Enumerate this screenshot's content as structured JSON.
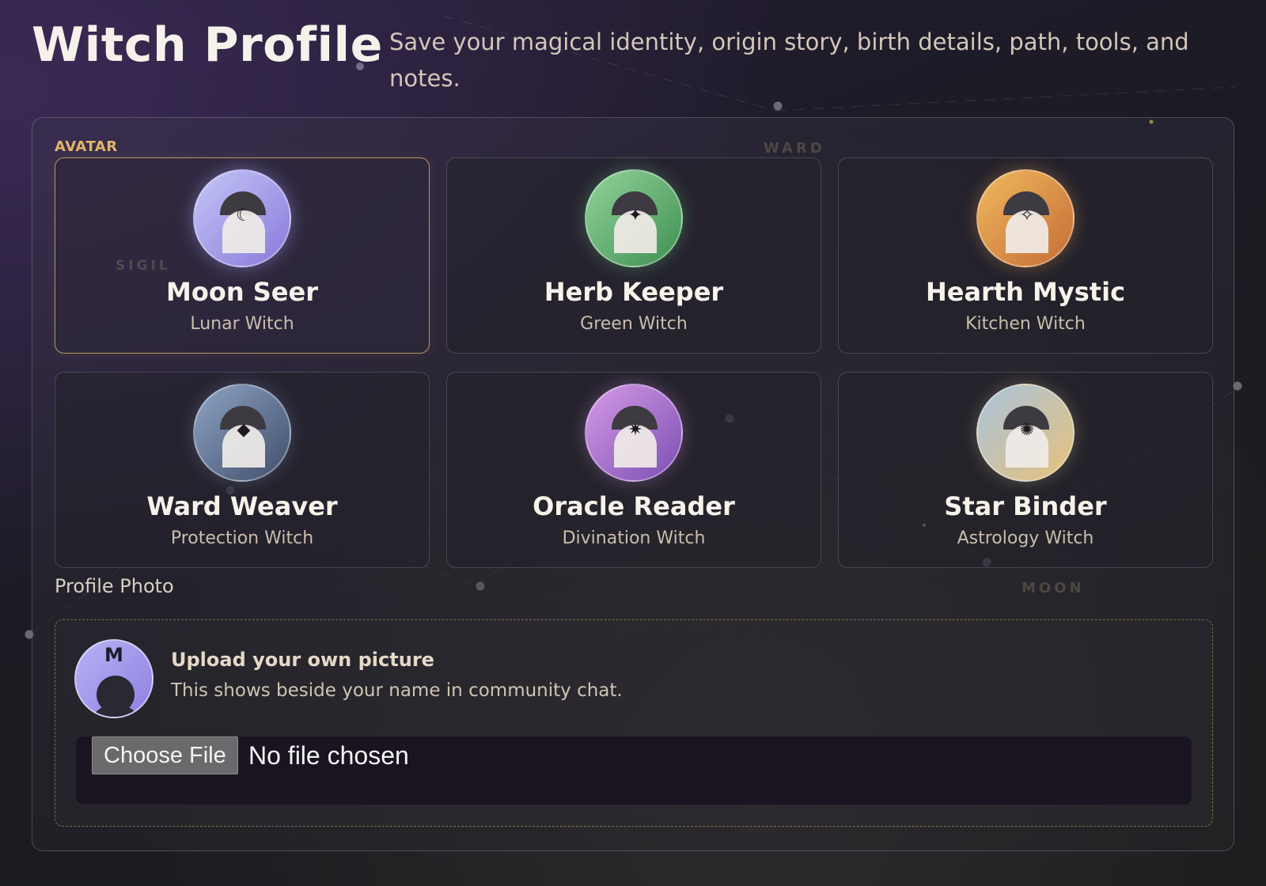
{
  "header": {
    "title": "Witch Profile",
    "subtitle": "Save your magical identity, origin story, birth details, path, tools, and notes."
  },
  "avatar_section": {
    "label": "AVATAR",
    "selected": "Moon Seer",
    "cards": [
      {
        "name": "Moon Seer",
        "type": "Lunar Witch",
        "symbol": "☾",
        "icon": "moon-icon",
        "gradient": [
          "#c4c6f8",
          "#8a79d9"
        ]
      },
      {
        "name": "Herb Keeper",
        "type": "Green Witch",
        "symbol": "✦",
        "icon": "four-point-star-icon",
        "gradient": [
          "#92d39a",
          "#3f8f53"
        ]
      },
      {
        "name": "Hearth Mystic",
        "type": "Kitchen Witch",
        "symbol": "✧",
        "icon": "sparkle-icon",
        "gradient": [
          "#f0b85e",
          "#c46d35"
        ]
      },
      {
        "name": "Ward Weaver",
        "type": "Protection Witch",
        "symbol": "◆",
        "icon": "diamond-icon",
        "gradient": [
          "#8ea3c4",
          "#3f4e6b"
        ]
      },
      {
        "name": "Oracle Reader",
        "type": "Divination Witch",
        "symbol": "✷",
        "icon": "eight-point-star-icon",
        "gradient": [
          "#d69ae6",
          "#7b4fb3"
        ]
      },
      {
        "name": "Star Binder",
        "type": "Astrology Witch",
        "symbol": "✺",
        "icon": "sunburst-icon",
        "gradient": [
          "#a9c3dc",
          "#e7c27a"
        ]
      }
    ]
  },
  "watermarks": [
    "SIGIL",
    "WARD",
    "MOON"
  ],
  "photo": {
    "label": "Profile Photo",
    "avatar_initial": "M",
    "upload_title": "Upload your own picture",
    "upload_desc": "This shows beside your name in community chat.",
    "choose_label": "Choose File",
    "file_status": "No file chosen"
  },
  "colors": {
    "accent_gold": "#e2b567",
    "selected_border": "#b8955a",
    "background": "#1d1b26"
  }
}
